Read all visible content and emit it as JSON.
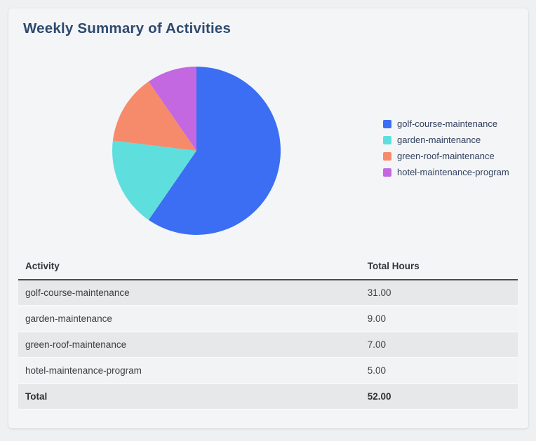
{
  "card": {
    "title": "Weekly Summary of Activities"
  },
  "chart_data": {
    "type": "pie",
    "title": "Weekly Summary of Activities",
    "categories": [
      "golf-course-maintenance",
      "garden-maintenance",
      "green-roof-maintenance",
      "hotel-maintenance-program"
    ],
    "values": [
      31,
      9,
      7,
      5
    ],
    "total": 52,
    "colors": [
      "#3b6ef2",
      "#5fdede",
      "#f68b6c",
      "#c368e1"
    ],
    "legend_position": "right",
    "start_angle": "top",
    "direction": "clockwise"
  },
  "table": {
    "columns": [
      "Activity",
      "Total Hours"
    ],
    "rows": [
      {
        "activity": "golf-course-maintenance",
        "hours": "31.00"
      },
      {
        "activity": "garden-maintenance",
        "hours": "9.00"
      },
      {
        "activity": "green-roof-maintenance",
        "hours": "7.00"
      },
      {
        "activity": "hotel-maintenance-program",
        "hours": "5.00"
      }
    ],
    "total_row": {
      "label": "Total",
      "hours": "52.00"
    }
  },
  "theme": {
    "title_color": "#2e4a6e",
    "legend_text_color": "#32415f",
    "card_background": "#f4f5f7",
    "page_background": "#eef0f2"
  }
}
